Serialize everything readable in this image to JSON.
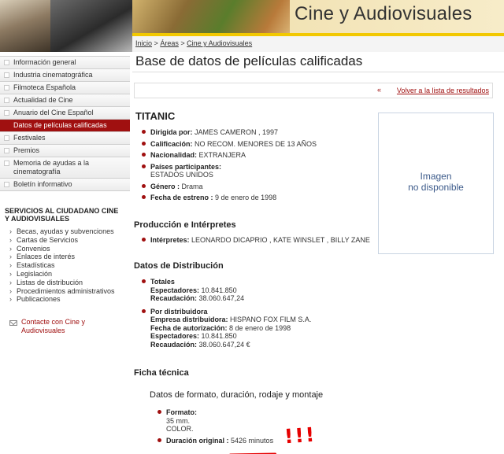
{
  "header": {
    "site_title": "Cine y Audiovisuales"
  },
  "sidebar": {
    "items": [
      {
        "label": "Información general",
        "active": false
      },
      {
        "label": "Industria cinematográfica",
        "active": false
      },
      {
        "label": "Filmoteca Española",
        "active": false
      },
      {
        "label": "Actualidad de Cine",
        "active": false
      },
      {
        "label": "Anuario del Cine Español",
        "active": false
      },
      {
        "label": "Datos de películas calificadas",
        "active": true
      },
      {
        "label": "Festivales",
        "active": false
      },
      {
        "label": "Premios",
        "active": false
      },
      {
        "label": "Memoria de ayudas a la cinematografía",
        "active": false
      },
      {
        "label": "Boletín informativo",
        "active": false
      }
    ],
    "services_title": "SERVICIOS AL CIUDADANO CINE Y AUDIOVISUALES",
    "services": [
      "Becas, ayudas y subvenciones",
      "Cartas de Servicios",
      "Convenios",
      "Enlaces de interés",
      "Estadísticas",
      "Legislación",
      "Listas de distribución",
      "Procedimientos administrativos",
      "Publicaciones"
    ],
    "contact": "Contacte con Cine y Audiovisuales"
  },
  "breadcrumb": {
    "items": [
      "Inicio",
      "Áreas",
      "Cine y Audiovisuales"
    ],
    "sep": ">"
  },
  "main": {
    "page_title": "Base de datos de películas calificadas",
    "back_link": "Volver a la lista de resultados",
    "movie_title": "TITANIC",
    "image_placeholder_line1": "Imagen",
    "image_placeholder_line2": "no disponible",
    "details": [
      {
        "label": "Dirigida por:",
        "value": "JAMES CAMERON , 1997"
      },
      {
        "label": "Calificación:",
        "value": "NO RECOM. MENORES DE 13 AÑOS"
      },
      {
        "label": "Nacionalidad:",
        "value": "EXTRANJERA"
      },
      {
        "label": "Países participantes:",
        "value": "ESTADOS UNIDOS"
      },
      {
        "label": "Género :",
        "value": "Drama"
      },
      {
        "label": "Fecha de estreno :",
        "value": "9 de enero de 1998"
      }
    ],
    "production_title": "Producción e Intérpretes",
    "interpretes_label": "Intérpretes:",
    "interpretes_value": "LEONARDO DICAPRIO , KATE WINSLET , BILLY ZANE",
    "distribution_title": "Datos de Distribución",
    "totales": {
      "label": "Totales",
      "espectadores_label": "Espectadores:",
      "espectadores": "10.841.850",
      "recaudacion_label": "Recaudación:",
      "recaudacion": "38.060.647,24"
    },
    "por_distribuidora": {
      "label": "Por distribuidora",
      "empresa_label": "Empresa distribuidora:",
      "empresa": "HISPANO FOX FILM S.A.",
      "fecha_label": "Fecha de autorización:",
      "fecha": "8 de enero de 1998",
      "espectadores_label": "Espectadores:",
      "espectadores": "10.841.850",
      "recaudacion_label": "Recaudación:",
      "recaudacion": "38.060.647,24 €"
    },
    "ficha_title": "Ficha técnica",
    "ficha_subtitle": "Datos de formato, duración, rodaje y montaje",
    "formato_label": "Formato:",
    "formato_lines": [
      "35 mm.",
      "COLOR."
    ],
    "duracion_label": "Duración original :",
    "duracion_value": "5426 minutos",
    "annotation": "!!!"
  },
  "colors": {
    "accent": "#a01010",
    "header_yellow": "#f2c800",
    "annotation_red": "#e60000"
  }
}
